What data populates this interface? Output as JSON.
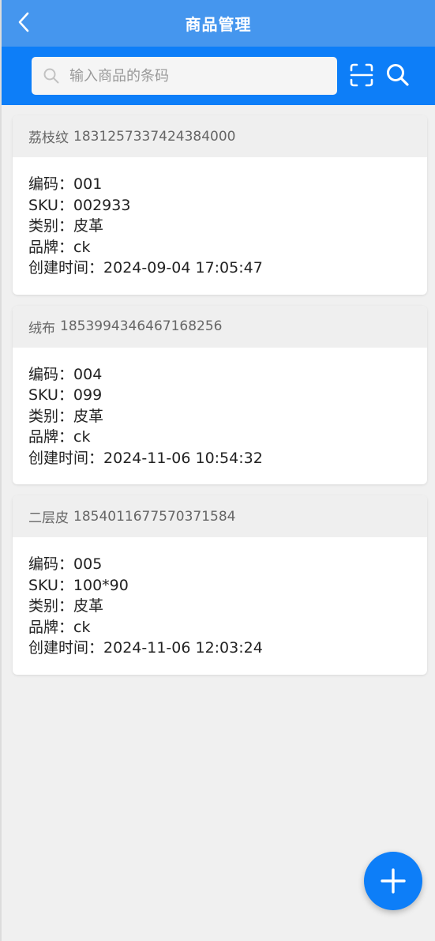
{
  "navbar": {
    "title": "商品管理",
    "back_icon": "chevron-left-icon",
    "background": "#4596ee"
  },
  "search": {
    "placeholder": "输入商品的条码",
    "value": "",
    "background": "#0d7ef8",
    "icons": [
      "search-icon",
      "scan-icon",
      "search-icon"
    ]
  },
  "products": [
    {
      "name": "荔枝纹",
      "barcode": "1831257337424384000",
      "code_label": "编码：",
      "code": "001",
      "sku_label": "SKU：",
      "sku": "002933",
      "category_label": "类别：",
      "category": "皮革",
      "brand_label": "品牌：",
      "brand": "ck",
      "created_label": "创建时间：",
      "created": "2024-09-04 17:05:47"
    },
    {
      "name": "绒布",
      "barcode": "1853994346467168256",
      "code_label": "编码：",
      "code": "004",
      "sku_label": "SKU：",
      "sku": "099",
      "category_label": "类别：",
      "category": "皮革",
      "brand_label": "品牌：",
      "brand": "ck",
      "created_label": "创建时间：",
      "created": "2024-11-06 10:54:32"
    },
    {
      "name": "二层皮",
      "barcode": "1854011677570371584",
      "code_label": "编码：",
      "code": "005",
      "sku_label": "SKU：",
      "sku": "100*90",
      "category_label": "类别：",
      "category": "皮革",
      "brand_label": "品牌：",
      "brand": "ck",
      "created_label": "创建时间：",
      "created": "2024-11-06 12:03:24"
    }
  ],
  "fab": {
    "icon": "plus-icon",
    "color": "#0d7ef8"
  }
}
